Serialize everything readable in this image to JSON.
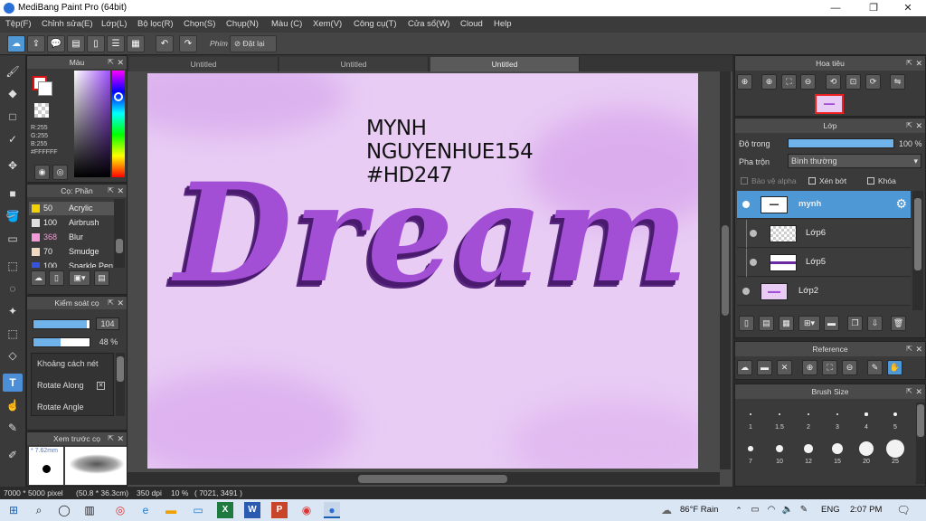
{
  "window": {
    "title": "MediBang Paint Pro (64bit)",
    "min": "—",
    "max": "❐",
    "close": "✕"
  },
  "menu": [
    "Tệp(F)",
    "Chỉnh sửa(E)",
    "Lớp(L)",
    "Bộ lọc(R)",
    "Chọn(S)",
    "Chụp(N)",
    "Màu (C)",
    "Xem(V)",
    "Công cụ(T)",
    "Cửa sổ(W)",
    "Cloud",
    "Help"
  ],
  "toolbar": {
    "phim": "Phím",
    "datlai": "Đặt lại"
  },
  "tabs": [
    "Untitled",
    "Untitled",
    "Untitled"
  ],
  "color_panel": {
    "title": "Màu",
    "r": "R:255",
    "g": "G:255",
    "b": "B:255",
    "hex": "#FFFFFF"
  },
  "brush_list": {
    "title": "Cọ: Phần",
    "items": [
      {
        "size": "50",
        "name": "Acrylic",
        "color": "#f2d200"
      },
      {
        "size": "100",
        "name": "Airbrush",
        "color": "#dddddd"
      },
      {
        "size": "368",
        "name": "Blur",
        "color": "#f39ad8"
      },
      {
        "size": "70",
        "name": "Smudge",
        "color": "#f1d8c0"
      },
      {
        "size": "100",
        "name": "Sparkle Pen",
        "color": "#3553e0"
      }
    ]
  },
  "brush_control": {
    "title": "Kiểm soát cọ",
    "size_val": "104",
    "size_fill": 0.95,
    "opacity_val": "48 %",
    "opacity_fill": 0.48,
    "opts": [
      "Khoảng cách nét",
      "Rotate Along",
      "Rotate Angle"
    ]
  },
  "preview": {
    "title": "Xem trước cọ",
    "size": "* 7.62mm"
  },
  "canvas": {
    "line1": "MYNH",
    "line2": "NGUYENHUE154",
    "line3": "#HD247",
    "word": "Dream"
  },
  "navigator": {
    "title": "Hoa tiêu"
  },
  "layer_panel": {
    "title": "Lớp",
    "opacity_label": "Độ trong",
    "opacity_val": "100 %",
    "opacity_fill": 1.0,
    "blend_label": "Pha trộn",
    "blend_val": "Bình thường",
    "alpha_label": "Bảo vệ alpha",
    "clip_label": "Xén bớt",
    "lock_label": "Khóa",
    "layers": [
      "mynh",
      "Lớp6",
      "Lớp5",
      "Lớp2"
    ]
  },
  "reference": {
    "title": "Reference"
  },
  "brush_size": {
    "title": "Brush Size",
    "sizes": [
      "1",
      "1.5",
      "2",
      "3",
      "4",
      "5",
      "7",
      "10",
      "12",
      "15",
      "20",
      "25"
    ]
  },
  "status": {
    "dims": "7000 * 5000 pixel",
    "mm": "(50.8 * 36.3cm)",
    "dpi": "350 dpi",
    "zoom": "10 %",
    "coords": "( 7021, 3491 )"
  },
  "taskbar": {
    "weather": "86°F Rain",
    "lang": "ENG",
    "time": "2:07 PM"
  },
  "colors": {
    "accent": "#4e98d6",
    "lettering": "#a24fd6",
    "paper": "#e8ccf4"
  }
}
